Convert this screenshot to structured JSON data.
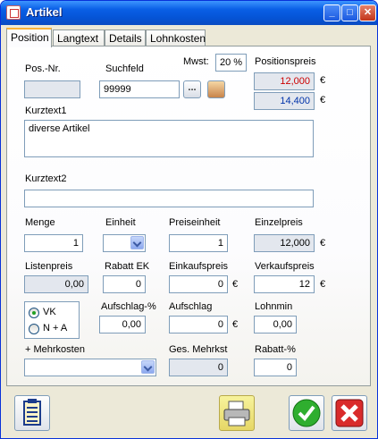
{
  "window": {
    "title": "Artikel",
    "minimize": "_",
    "maximize": "□",
    "close": "✕"
  },
  "tabs": [
    "Position",
    "Langtext",
    "Details",
    "Lohnkosten"
  ],
  "labels": {
    "posnr": "Pos.-Nr.",
    "suchfeld": "Suchfeld",
    "mwst": "Mwst:",
    "positionspreis": "Positionspreis",
    "kurztext1": "Kurztext1",
    "kurztext2": "Kurztext2",
    "menge": "Menge",
    "einheit": "Einheit",
    "preiseinheit": "Preiseinheit",
    "einzelpreis": "Einzelpreis",
    "listenpreis": "Listenpreis",
    "rabatt_ek": "Rabatt EK",
    "einkaufspreis": "Einkaufspreis",
    "verkaufspreis": "Verkaufspreis",
    "aufschlag_pct": "Aufschlag-%",
    "aufschlag": "Aufschlag",
    "lohnmin": "Lohnmin",
    "mehrkosten": "+ Mehrkosten",
    "ges_mehrkst": "Ges. Mehrkst",
    "rabatt_pct": "Rabatt-%"
  },
  "values": {
    "posnr": "",
    "suchfeld": "99999",
    "mwst": "20 %",
    "positionspreis_red": "12,000",
    "positionspreis_blue": "14,400",
    "kurztext1": "diverse Artikel",
    "kurztext2": "",
    "menge": "1",
    "einheit": "",
    "preiseinheit": "1",
    "einzelpreis": "12,000",
    "listenpreis": "0,00",
    "rabatt_ek": "0",
    "einkaufspreis": "0",
    "verkaufspreis": "12",
    "aufschlag_pct": "0,00",
    "aufschlag": "0",
    "lohnmin": "0,00",
    "mehrkosten": "",
    "ges_mehrkst": "0",
    "rabatt_pct": "0"
  },
  "radio": {
    "vk": "VK",
    "na": "N + A",
    "selected": "VK"
  },
  "currency": "€",
  "buttons": {
    "browse": "...",
    "article_icon": "package-icon"
  },
  "bottom_icons": [
    "clipboard-list-icon",
    "printer-icon",
    "ok-checkmark-icon",
    "cancel-x-icon"
  ],
  "colors": {
    "red_price": "#cc0000",
    "blue_price": "#0033aa",
    "accent_tab": "#f9b339"
  }
}
